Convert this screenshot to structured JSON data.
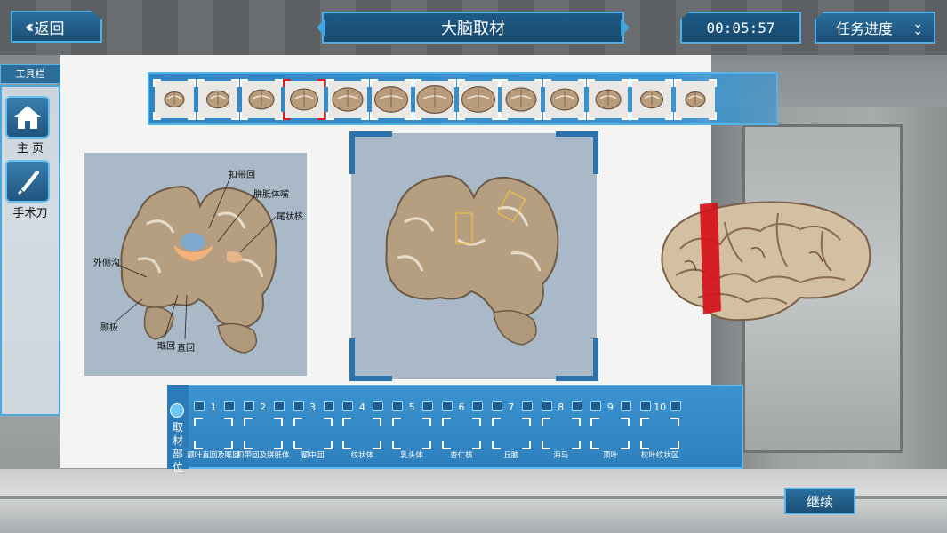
{
  "header": {
    "back_label": "返回",
    "title": "大脑取材",
    "timer": "00:05:57",
    "progress_label": "任务进度"
  },
  "toolbar": {
    "title": "工具栏",
    "tools": [
      {
        "label": "主 页",
        "icon": "home-icon"
      },
      {
        "label": "手术刀",
        "icon": "scalpel-icon"
      }
    ]
  },
  "slices": {
    "count": 13,
    "selected_index": 3
  },
  "reference": {
    "labels": [
      "扣带回",
      "胼胝体嘴",
      "尾状核",
      "外侧沟",
      "颞极",
      "眶回",
      "直回"
    ]
  },
  "sampling": {
    "title": "取材部位",
    "slots": [
      {
        "num": "1",
        "name": "额叶直回及眶回"
      },
      {
        "num": "2",
        "name": "扣带回及胼胝体"
      },
      {
        "num": "3",
        "name": "额中回"
      },
      {
        "num": "4",
        "name": "纹状体"
      },
      {
        "num": "5",
        "name": "乳头体"
      },
      {
        "num": "6",
        "name": "杏仁核"
      },
      {
        "num": "7",
        "name": "丘脑"
      },
      {
        "num": "8",
        "name": "海马"
      },
      {
        "num": "9",
        "name": "顶叶"
      },
      {
        "num": "10",
        "name": "枕叶纹状区"
      }
    ]
  },
  "footer": {
    "continue_label": "继续"
  },
  "colors": {
    "accent": "#4fb0e6",
    "panel_blue": "#2e80bd",
    "selected_slice": "#e21c1c",
    "cut_marker": "#d4121a"
  }
}
